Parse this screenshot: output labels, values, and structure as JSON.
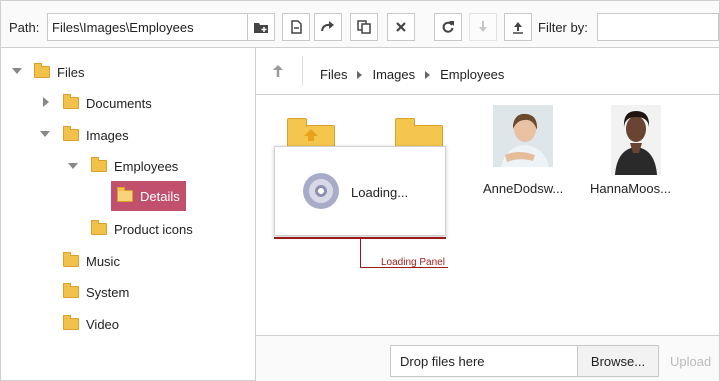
{
  "toolbar": {
    "path_label": "Path:",
    "path_value": "Files\\Images\\Employees",
    "filter_label": "Filter by:",
    "filter_value": "",
    "buttons": [
      {
        "name": "create-folder",
        "icon": "folder-plus-icon"
      },
      {
        "name": "rename",
        "icon": "rename-icon"
      },
      {
        "name": "move",
        "icon": "redo-arrow-icon"
      },
      {
        "name": "copy",
        "icon": "copy-icon"
      },
      {
        "name": "delete",
        "icon": "close-icon"
      },
      {
        "name": "refresh",
        "icon": "refresh-icon"
      },
      {
        "name": "download",
        "icon": "download-icon",
        "disabled": true
      },
      {
        "name": "upload",
        "icon": "upload-icon"
      }
    ]
  },
  "tree": {
    "items": [
      {
        "label": "Files"
      },
      {
        "label": "Documents"
      },
      {
        "label": "Images"
      },
      {
        "label": "Employees"
      },
      {
        "label": "Details",
        "selected": true
      },
      {
        "label": "Product icons"
      },
      {
        "label": "Music"
      },
      {
        "label": "System"
      },
      {
        "label": "Video"
      }
    ]
  },
  "breadcrumb": {
    "items": [
      "Files",
      "Images",
      "Employees"
    ]
  },
  "items": [
    {
      "name": "AnneDodsw..."
    },
    {
      "name": "HannaMoos..."
    }
  ],
  "loading": {
    "text": "Loading..."
  },
  "annotation": {
    "text": "Loading Panel"
  },
  "footer": {
    "drop_text": "Drop files here",
    "browse_label": "Browse...",
    "upload_label": "Upload"
  },
  "colors": {
    "selected": "#c0506b",
    "folder": "#f2c14b",
    "annotation": "#9b1b1b"
  }
}
